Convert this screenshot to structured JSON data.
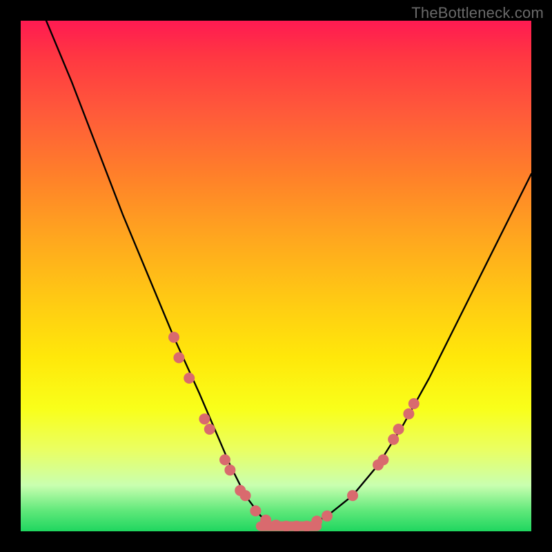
{
  "watermark": "TheBottleneck.com",
  "chart_data": {
    "type": "line",
    "title": "",
    "xlabel": "",
    "ylabel": "",
    "xlim": [
      0,
      100
    ],
    "ylim": [
      0,
      100
    ],
    "grid": false,
    "legend": false,
    "series": [
      {
        "name": "bottleneck-curve",
        "x": [
          5,
          10,
          15,
          20,
          25,
          30,
          35,
          38,
          41,
          44,
          47,
          50,
          53,
          56,
          60,
          65,
          70,
          75,
          80,
          85,
          90,
          95,
          100
        ],
        "y": [
          100,
          88,
          75,
          62,
          50,
          38,
          27,
          20,
          13,
          7,
          3,
          1,
          1,
          1,
          3,
          7,
          13,
          21,
          30,
          40,
          50,
          60,
          70
        ]
      }
    ],
    "markers": {
      "name": "highlight-dots",
      "color": "#d96a6e",
      "points": [
        {
          "x": 30,
          "y": 38
        },
        {
          "x": 31,
          "y": 34
        },
        {
          "x": 33,
          "y": 30
        },
        {
          "x": 36,
          "y": 22
        },
        {
          "x": 37,
          "y": 20
        },
        {
          "x": 40,
          "y": 14
        },
        {
          "x": 41,
          "y": 12
        },
        {
          "x": 43,
          "y": 8
        },
        {
          "x": 44,
          "y": 7
        },
        {
          "x": 46,
          "y": 4
        },
        {
          "x": 48,
          "y": 2.2
        },
        {
          "x": 50,
          "y": 1.2
        },
        {
          "x": 52,
          "y": 1.0
        },
        {
          "x": 54,
          "y": 1.0
        },
        {
          "x": 56,
          "y": 1.0
        },
        {
          "x": 58,
          "y": 2.0
        },
        {
          "x": 60,
          "y": 3.0
        },
        {
          "x": 65,
          "y": 7.0
        },
        {
          "x": 70,
          "y": 13.0
        },
        {
          "x": 71,
          "y": 14.0
        },
        {
          "x": 73,
          "y": 18.0
        },
        {
          "x": 74,
          "y": 20.0
        },
        {
          "x": 76,
          "y": 23.0
        },
        {
          "x": 77,
          "y": 25.0
        }
      ]
    },
    "bottom_band": {
      "name": "near-zero-band",
      "x_start": 47,
      "x_end": 58,
      "y": 1.0
    }
  }
}
